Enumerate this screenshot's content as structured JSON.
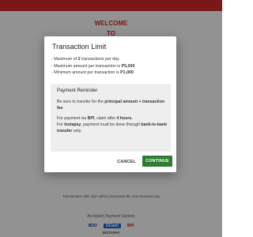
{
  "background": {
    "welcome_line1": "WELCOME",
    "welcome_line2": "TO",
    "processing_note": "Transactions after 4pm will be processed the next business day",
    "accepted_label": "Accepted Payment Options",
    "logos": [
      "BDO",
      "GCash",
      "BPI"
    ],
    "instapay_label": "INSTAPAY",
    "brand_color": "#c62828"
  },
  "modal": {
    "title": "Transaction Limit",
    "limits": [
      {
        "pre": "- Maximum of ",
        "strong": "2",
        "post": " transactions per day"
      },
      {
        "pre": "- Maximum amount per transaction is ",
        "strong": "P5,000",
        "post": ""
      },
      {
        "pre": "- Minimum amount per transaction is ",
        "strong": "P1,000",
        "post": ""
      }
    ],
    "reminder": {
      "title": "Payment Reminder",
      "p1_pre": "Be sure to transfer for the ",
      "p1_strong": "principal amount + transaction fee",
      "p2_a": "For payment via ",
      "p2_b": "BPI",
      "p2_c": ", claim after ",
      "p2_d": "4 hours.",
      "p2_e": "For ",
      "p2_f": "Instapay",
      "p2_g": ", payment must be done through ",
      "p2_h": "bank-to-bank transfer",
      "p2_i": " only."
    },
    "cancel_label": "CANCEL",
    "continue_label": "CONTINUE",
    "continue_color": "#2e7d32"
  }
}
